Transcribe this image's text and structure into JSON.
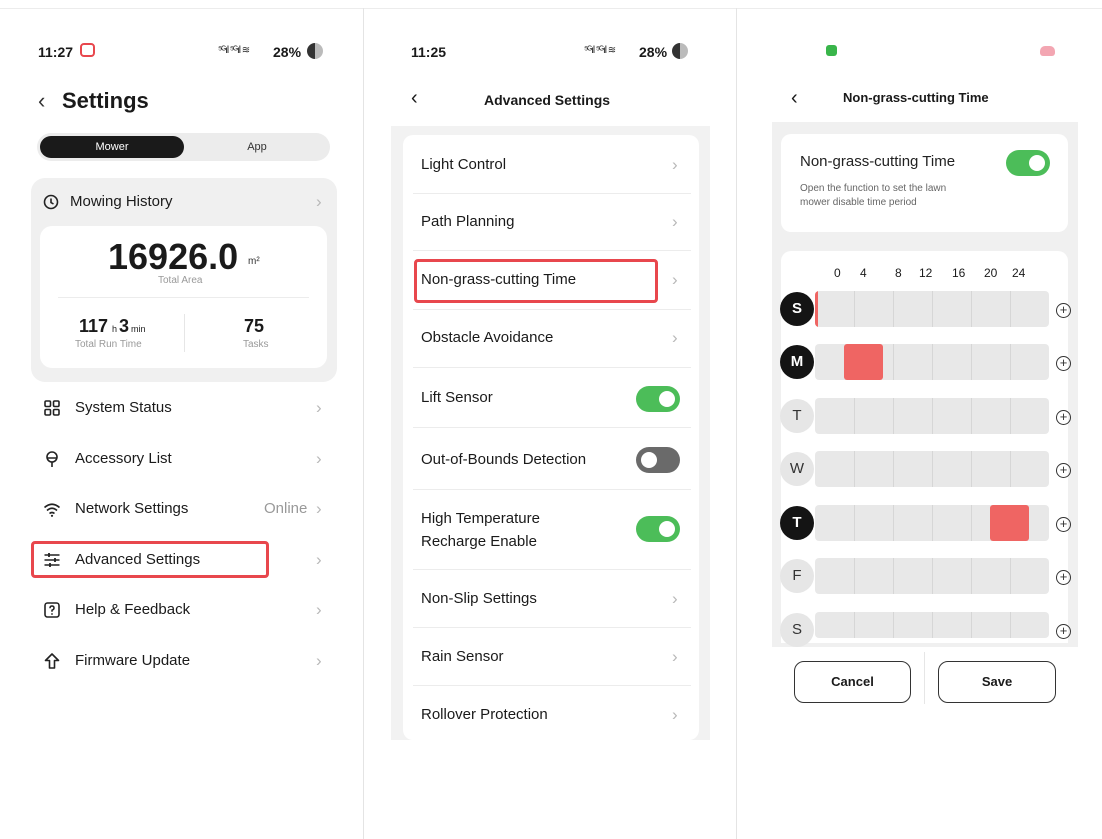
{
  "panel1": {
    "status_time": "11:27",
    "status_right": "28%",
    "title": "Settings",
    "tabs": [
      "Mower",
      "App"
    ],
    "mowing_history": {
      "label": "Mowing History",
      "area_value": "16926.0",
      "area_unit": "m²",
      "area_label": "Total Area",
      "runtime_hours": "117",
      "runtime_h_unit": "h",
      "runtime_minutes": "3",
      "runtime_min_unit": "min",
      "runtime_label": "Total Run Time",
      "tasks_value": "75",
      "tasks_label": "Tasks"
    },
    "menu": [
      {
        "label": "System Status",
        "icon": "grid-icon"
      },
      {
        "label": "Accessory List",
        "icon": "accessory-icon"
      },
      {
        "label": "Network Settings",
        "icon": "wifi-icon",
        "value": "Online"
      },
      {
        "label": "Advanced Settings",
        "icon": "sliders-icon"
      },
      {
        "label": "Help & Feedback",
        "icon": "help-icon"
      },
      {
        "label": "Firmware Update",
        "icon": "upload-icon"
      }
    ]
  },
  "panel2": {
    "status_time": "11:25",
    "status_right": "28%",
    "title": "Advanced Settings",
    "items": [
      {
        "label": "Light Control",
        "control": "chevron"
      },
      {
        "label": "Path Planning",
        "control": "chevron"
      },
      {
        "label": "Non-grass-cutting Time",
        "control": "chevron"
      },
      {
        "label": "Obstacle Avoidance",
        "control": "chevron"
      },
      {
        "label": "Lift Sensor",
        "control": "toggle",
        "on": true
      },
      {
        "label": "Out-of-Bounds Detection",
        "control": "toggle",
        "on": false
      },
      {
        "label": "High Temperature Recharge Enable",
        "line1": "High Temperature",
        "line2": "Recharge Enable",
        "control": "toggle",
        "on": true
      },
      {
        "label": "Non-Slip Settings",
        "control": "chevron"
      },
      {
        "label": "Rain Sensor",
        "control": "chevron"
      },
      {
        "label": "Rollover Protection",
        "control": "chevron"
      }
    ]
  },
  "panel3": {
    "title": "Non-grass-cutting Time",
    "card_title": "Non-grass-cutting Time",
    "card_desc_line1": "Open the function to set the lawn",
    "card_desc_line2": "mower disable time period",
    "toggle_on": true,
    "hours": [
      "0",
      "4",
      "8",
      "12",
      "16",
      "20",
      "24"
    ],
    "days": [
      {
        "letter": "S",
        "selected": true
      },
      {
        "letter": "M",
        "selected": true
      },
      {
        "letter": "T",
        "selected": false
      },
      {
        "letter": "W",
        "selected": false
      },
      {
        "letter": "T",
        "selected": true
      },
      {
        "letter": "F",
        "selected": false
      },
      {
        "letter": "S",
        "selected": false
      }
    ],
    "cancel_label": "Cancel",
    "save_label": "Save",
    "colors": {
      "accent_green": "#4cbd59",
      "block_red": "#ef6563",
      "highlight_red": "#e8474d"
    }
  }
}
